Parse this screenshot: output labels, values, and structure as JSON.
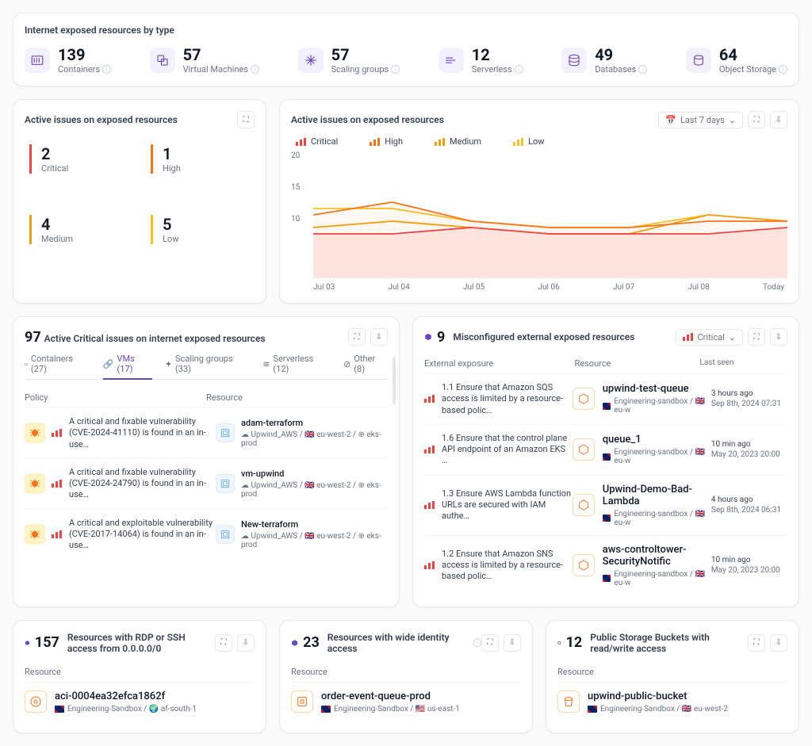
{
  "exposure": {
    "title": "Internet exposed resources by type",
    "stats": [
      {
        "count": "139",
        "label": "Containers"
      },
      {
        "count": "57",
        "label": "Virtual Machines"
      },
      {
        "count": "57",
        "label": "Scaling groups"
      },
      {
        "count": "12",
        "label": "Serverless"
      },
      {
        "count": "49",
        "label": "Databases"
      },
      {
        "count": "64",
        "label": "Object Storage"
      }
    ]
  },
  "active_issues_small": {
    "title": "Active issues on exposed resources",
    "items": [
      {
        "num": "2",
        "label": "Critical",
        "cls": "sev-crit"
      },
      {
        "num": "1",
        "label": "High",
        "cls": "sev-high"
      },
      {
        "num": "4",
        "label": "Medium",
        "cls": "sev-med"
      },
      {
        "num": "5",
        "label": "Low",
        "cls": "sev-low"
      }
    ]
  },
  "chart_panel": {
    "title": "Active issues on exposed resources",
    "range": "Last 7 days",
    "legend": [
      "Critical",
      "High",
      "Medium",
      "Low"
    ]
  },
  "chart_data": {
    "type": "line",
    "ylim": [
      0,
      20
    ],
    "yticks": [
      10,
      15,
      20
    ],
    "categories": [
      "Jul 03",
      "Jul 04",
      "Jul 05",
      "Jul 06",
      "Jul 07",
      "Jul 08",
      "Today"
    ],
    "series": [
      {
        "name": "Critical",
        "color": "#ef4444",
        "values": [
          7,
          7,
          8,
          7,
          7,
          7,
          8
        ]
      },
      {
        "name": "High",
        "color": "#f97316",
        "values": [
          10,
          12,
          9,
          8,
          8,
          9,
          9
        ]
      },
      {
        "name": "Medium",
        "color": "#f59e0b",
        "values": [
          8,
          9,
          8,
          7,
          7,
          10,
          9
        ]
      },
      {
        "name": "Low",
        "color": "#fbbf24",
        "values": [
          11,
          11,
          9,
          8,
          8,
          10,
          9
        ]
      }
    ]
  },
  "critical_table": {
    "count": "97",
    "title": "Active Critical issues on internet exposed resources",
    "tabs": [
      {
        "label": "Containers (27)"
      },
      {
        "label": "VMs (17)",
        "active": true
      },
      {
        "label": "Scaling groups (33)"
      },
      {
        "label": "Serverless (12)"
      },
      {
        "label": "Other (8)"
      }
    ],
    "cols": [
      "Policy",
      "Resource"
    ],
    "rows": [
      {
        "policy": "A critical and fixable vulnerability (CVE-2024-41110) is found in an in-use…",
        "res": "adam-terraform",
        "path": "Upwind_AWS / 🇬🇧 eu-west-2 / ⊕ eks-prod"
      },
      {
        "policy": "A critical and fixable vulnerability (CVE-2024-24790) is found in an in-use…",
        "res": "vm-upwind",
        "path": "Upwind_AWS / 🇬🇧 eu-west-2 / ⊕ eks-prod"
      },
      {
        "policy": "A critical and exploitable vulnerability (CVE-2017-14064) is found in an in-use…",
        "res": "New-terraform",
        "path": "Upwind_AWS / 🇬🇧 eu-west-2 / ⊕ eks-prod"
      }
    ]
  },
  "misconf": {
    "count": "9",
    "title": "Misconfigured external exposed resources",
    "severity": "Critical",
    "cols": [
      "External exposure",
      "Resource",
      "Last seen"
    ],
    "rows": [
      {
        "exp": "1.1 Ensure that Amazon SQS access is limited by a resource-based polic…",
        "res": "upwind-test-queue",
        "path": "Engineering-sandbox / 🇬🇧 eu-w",
        "t1": "3 hours ago",
        "t2": "Sep 8th, 2024 07:31"
      },
      {
        "exp": "1.6 Ensure that the control plane API endpoint of an Amazon EKS …",
        "res": "queue_1",
        "path": "Engineering-sandbox / 🇬🇧 eu-w",
        "t1": "10 min ago",
        "t2": "May 20, 2023 20:00"
      },
      {
        "exp": "1.3 Ensure AWS Lambda function URLs are secured with IAM authe…",
        "res": "Upwind-Demo-Bad-Lambda",
        "path": "Engineering-sandbox / 🇬🇧 eu-w",
        "t1": "4 hours ago",
        "t2": "Sep 8th, 2024 06:31"
      },
      {
        "exp": "1.2 Ensure that Amazon SNS access is limited by a resource-based polic…",
        "res": "aws-controltower-SecurityNotific",
        "path": "Engineering-sandbox / 🇬🇧 eu-w",
        "t1": "10 min ago",
        "t2": "May 20, 2023 20:00"
      }
    ]
  },
  "bottom": [
    {
      "count": "157",
      "title": "Resources with RDP or SSH access from 0.0.0.0/0",
      "col": "Resource",
      "res": "aci-0004ea32efca1862f",
      "path": "Engineering-Sandbox / 🌍 af-south-1"
    },
    {
      "count": "23",
      "title": "Resources with wide identity access",
      "col": "Resource",
      "res": "order-event-queue-prod",
      "path": "Engineering-Sandbox / 🇺🇸 us-east-1"
    },
    {
      "count": "12",
      "title": "Public Storage Buckets with read/write access",
      "col": "Resource",
      "res": "upwind-public-bucket",
      "path": "Engineering-Sandbox / 🇬🇧 eu-west-2"
    }
  ]
}
